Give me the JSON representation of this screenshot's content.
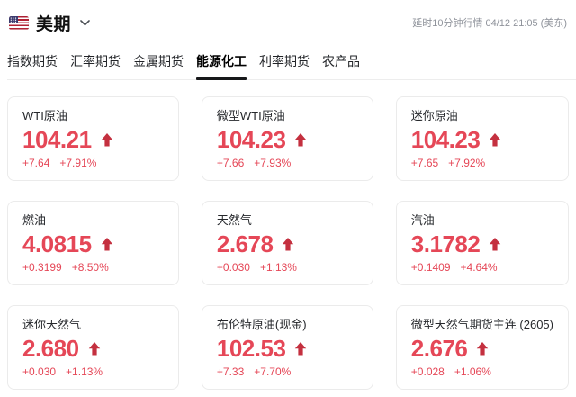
{
  "header": {
    "flag_icon": "us-flag",
    "title": "美期",
    "delay_info": "延时10分钟行情 04/12 21:05 (美东)"
  },
  "tabs": [
    {
      "label": "指数期货",
      "active": false
    },
    {
      "label": "汇率期货",
      "active": false
    },
    {
      "label": "金属期货",
      "active": false
    },
    {
      "label": "能源化工",
      "active": true
    },
    {
      "label": "利率期货",
      "active": false
    },
    {
      "label": "农产品",
      "active": false
    }
  ],
  "colors": {
    "up": "#e54757",
    "arrow": "#c4303f",
    "active_tab_underline": "#17181a"
  },
  "cards": [
    {
      "name": "WTI原油",
      "price": "104.21",
      "change": "+7.64",
      "change_pct": "+7.91%",
      "direction": "up"
    },
    {
      "name": "微型WTI原油",
      "price": "104.23",
      "change": "+7.66",
      "change_pct": "+7.93%",
      "direction": "up"
    },
    {
      "name": "迷你原油",
      "price": "104.23",
      "change": "+7.65",
      "change_pct": "+7.92%",
      "direction": "up"
    },
    {
      "name": "燃油",
      "price": "4.0815",
      "change": "+0.3199",
      "change_pct": "+8.50%",
      "direction": "up"
    },
    {
      "name": "天然气",
      "price": "2.678",
      "change": "+0.030",
      "change_pct": "+1.13%",
      "direction": "up"
    },
    {
      "name": "汽油",
      "price": "3.1782",
      "change": "+0.1409",
      "change_pct": "+4.64%",
      "direction": "up"
    },
    {
      "name": "迷你天然气",
      "price": "2.680",
      "change": "+0.030",
      "change_pct": "+1.13%",
      "direction": "up"
    },
    {
      "name": "布伦特原油(现金)",
      "price": "102.53",
      "change": "+7.33",
      "change_pct": "+7.70%",
      "direction": "up"
    },
    {
      "name": "微型天然气期货主连 (2605)",
      "price": "2.676",
      "change": "+0.028",
      "change_pct": "+1.06%",
      "direction": "up"
    }
  ]
}
